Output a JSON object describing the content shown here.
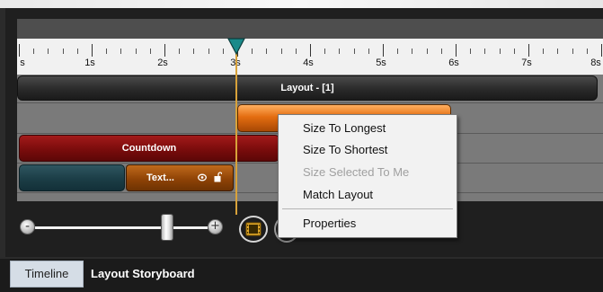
{
  "ruler": {
    "labels": [
      "s",
      "1s",
      "2s",
      "3s",
      "4s",
      "5s",
      "6s",
      "7s",
      "8s"
    ]
  },
  "tracks": {
    "layout_label": "Layout - [1]",
    "countdown_label": "Countdown",
    "text_label": "Text..."
  },
  "context_menu": {
    "items": [
      {
        "label": "Size To Longest",
        "enabled": true
      },
      {
        "label": "Size To Shortest",
        "enabled": true
      },
      {
        "label": "Size Selected To Me",
        "enabled": false
      },
      {
        "label": "Match Layout",
        "enabled": true
      },
      {
        "label": "Properties",
        "enabled": true
      }
    ]
  },
  "zoom": {
    "minus": "-",
    "plus": "+",
    "level": 0.77
  },
  "tabs": [
    {
      "label": "Timeline",
      "active": true
    },
    {
      "label": "Layout Storyboard",
      "active": false
    }
  ],
  "playhead": {
    "time_seconds": 3
  },
  "colors": {
    "accent_playhead": "#1a8a8a",
    "countdown": "#8b1111",
    "text_clip": "#9a4a08",
    "layout_clip": "#2a2a2a"
  }
}
